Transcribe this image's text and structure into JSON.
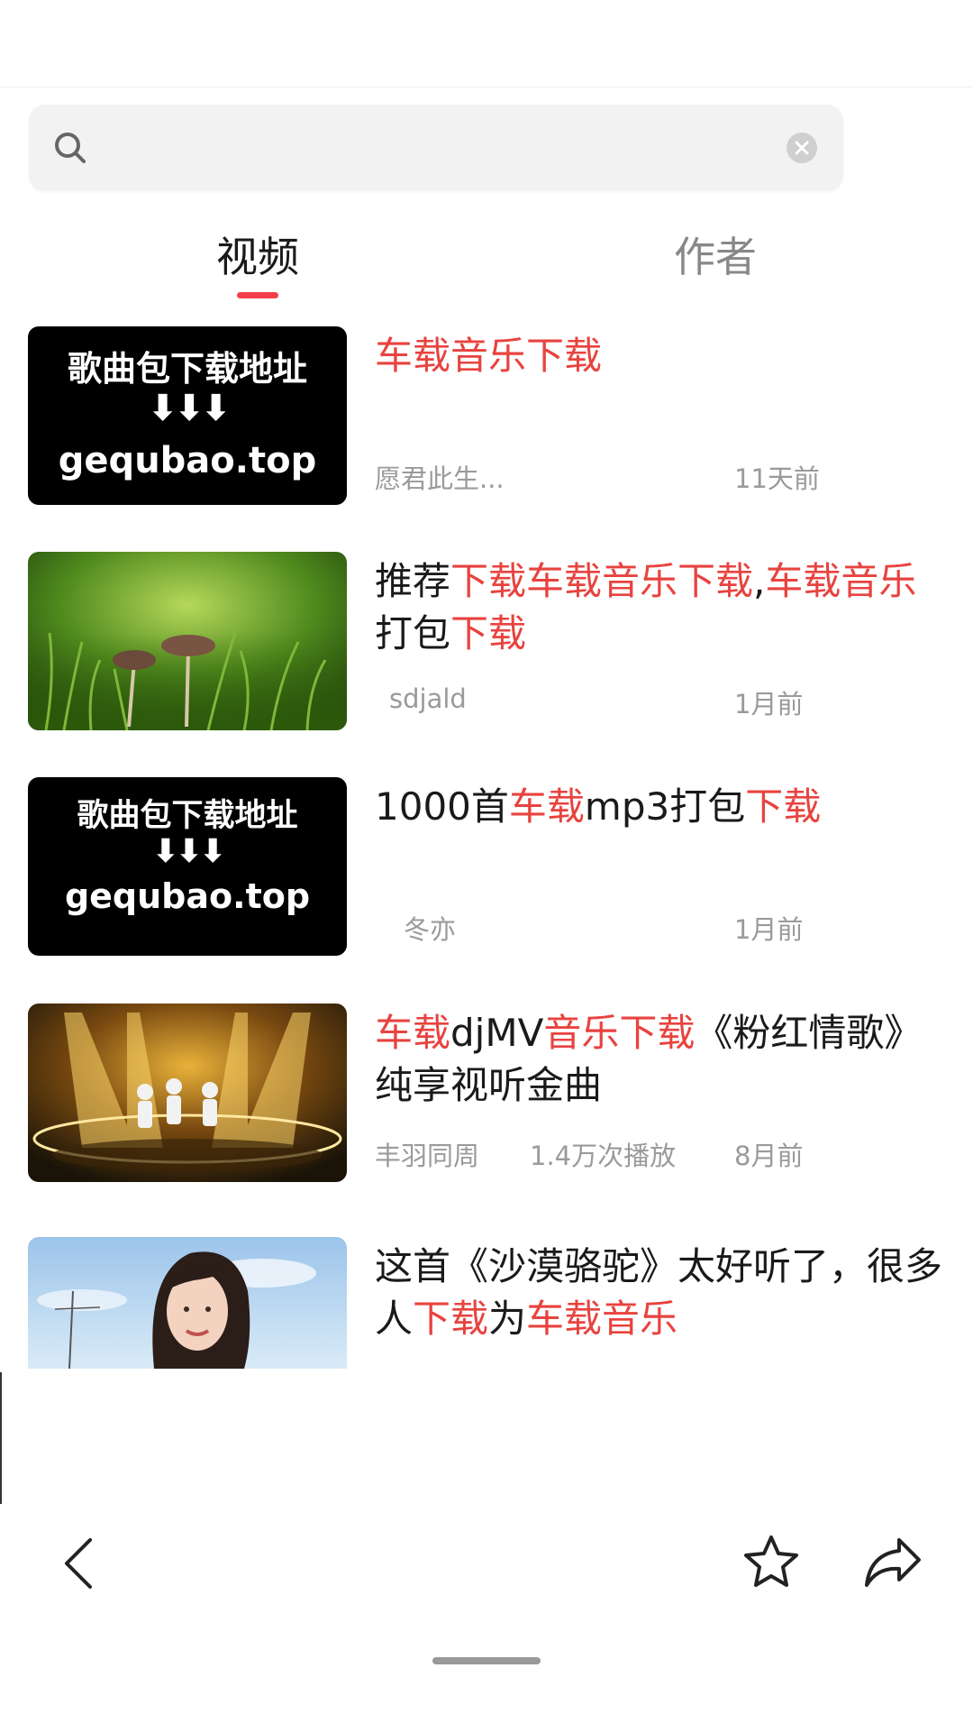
{
  "search": {
    "value": "",
    "placeholder": ""
  },
  "tabs": [
    {
      "label": "视频",
      "active": true
    },
    {
      "label": "作者",
      "active": false
    }
  ],
  "results": [
    {
      "thumb": {
        "type": "text-card",
        "line1": "歌曲包下载地址",
        "arrows": "⬇⬇⬇",
        "line3": "gequbao.top"
      },
      "title_parts": [
        {
          "text": "车载音乐下载",
          "hl": true
        }
      ],
      "author": "愿君此生...",
      "plays": "",
      "time": "11天前"
    },
    {
      "thumb": {
        "type": "mushroom-photo"
      },
      "title_parts": [
        {
          "text": "推荐",
          "hl": false
        },
        {
          "text": "下载车载音乐下载",
          "hl": true
        },
        {
          "text": ",",
          "hl": false
        },
        {
          "text": "车载音乐",
          "hl": true
        },
        {
          "text": "打包",
          "hl": false
        },
        {
          "text": "下载",
          "hl": true
        }
      ],
      "author": "sdjald",
      "plays": "",
      "time": "1月前"
    },
    {
      "thumb": {
        "type": "text-card",
        "line1": "歌曲包下载地址",
        "arrows": "⬇⬇⬇",
        "line3": "gequbao.top"
      },
      "title_parts": [
        {
          "text": "1000首",
          "hl": false
        },
        {
          "text": "车载",
          "hl": true
        },
        {
          "text": "mp3打包",
          "hl": false
        },
        {
          "text": "下载",
          "hl": true
        }
      ],
      "author": "冬亦",
      "plays": "",
      "time": "1月前"
    },
    {
      "thumb": {
        "type": "stage-photo"
      },
      "title_parts": [
        {
          "text": "车载",
          "hl": true
        },
        {
          "text": "djMV",
          "hl": false
        },
        {
          "text": "音乐下载",
          "hl": true
        },
        {
          "text": "《粉红情歌》纯享视听金曲",
          "hl": false
        }
      ],
      "author": "丰羽同周",
      "plays": "1.4万次播放",
      "time": "8月前"
    },
    {
      "thumb": {
        "type": "portrait-photo"
      },
      "title_parts": [
        {
          "text": "这首《沙漠骆驼》太好听了，很多人",
          "hl": false
        },
        {
          "text": "下载",
          "hl": true
        },
        {
          "text": "为",
          "hl": false
        },
        {
          "text": "车载音乐",
          "hl": true
        }
      ],
      "author": "",
      "plays": "",
      "time": ""
    }
  ],
  "colors": {
    "highlight": "#e8433f",
    "tab_indicator": "#f2404a"
  },
  "icons": [
    "search-icon",
    "clear-icon",
    "back-icon",
    "star-icon",
    "share-icon"
  ]
}
